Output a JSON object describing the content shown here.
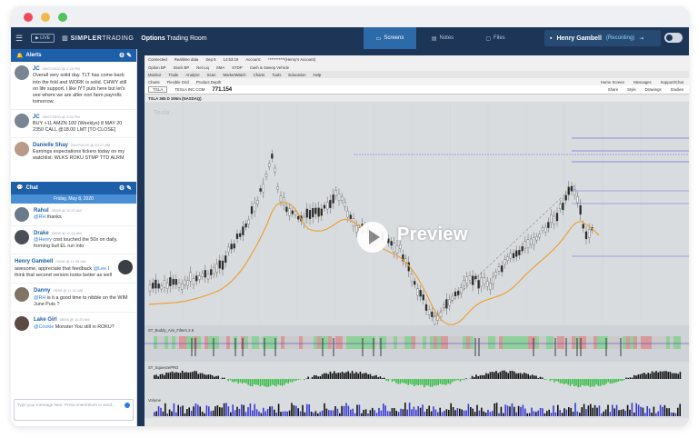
{
  "app": {
    "live_label": "LIVE",
    "brand_bold": "SIMPLER",
    "brand_rest": "TRADING",
    "room_bold": "Options",
    "room_rest": " Trading Room"
  },
  "tabs": [
    {
      "label": "Screens",
      "icon": "monitor-icon"
    },
    {
      "label": "Notes",
      "icon": "notes-icon"
    },
    {
      "label": "Files",
      "icon": "folder-icon"
    }
  ],
  "user": {
    "name": "Henry Gambell",
    "status": "(Recording)"
  },
  "alerts_panel": {
    "title": "Alerts",
    "items": [
      {
        "who": "JC",
        "time": "05/07/2020 @ 2:19 PM",
        "text": "Overall very solid day. TLT has come back into the fold and WORK is solid. CHWY still on life support. I like IYT puts here but let's see where we are after non farm payrolls tomorrow."
      },
      {
        "who": "JC",
        "time": "05/07/2020 @ 2:02 PM",
        "text": "BUY +11 AMZN 100 (Weeklys) 8 MAY 20 2350 CALL @18.00 LMT [TO CLOSE]"
      },
      {
        "who": "Danielle Shay",
        "time": "05/07/2020 @ 10:27 AM",
        "text": "Earnings expectations tickers today on my watchlist: WLKS ROKU STMP TTD ALRM"
      }
    ]
  },
  "chat_panel": {
    "title": "Chat",
    "day": "Friday, May 8, 2020",
    "items": [
      {
        "who": "Rahul",
        "time": "05/08 @ 11:20 AM",
        "mention": "@RH",
        "text": " thanks"
      },
      {
        "who": "Drake",
        "time": "05/08 @ 11:24 AM",
        "mention": "@Henry",
        "text": " cost touched the 50s on daily, forming bull EL run into"
      },
      {
        "who": "Henry Gambell",
        "time": "05/08 @ 11:28 AM",
        "mention": "",
        "text": "awesome, appreciate that feedback ",
        "mention2": "@Lee",
        "text2": " I think that second version looks better as well"
      },
      {
        "who": "Danny",
        "time": "05/08 @ 11:31 AM",
        "mention": "@RH",
        "text": " is it a good time to nibble on the WIM June Puts ?"
      },
      {
        "who": "Lake Girl",
        "time": "05/08 @ 11:33 AM",
        "mention": "@Cookie",
        "text": " Monster You still in ROKU?"
      }
    ],
    "input_placeholder": "Type your message here. Press enter/return to send..."
  },
  "platform": {
    "menu_1": [
      "Connected",
      "Realtime data",
      "Sep 8",
      "14:53:19",
      "Account:",
      "***********(Henry's Account)"
    ],
    "menu_2": [
      "Option BP",
      "Stock BP",
      "Net Liq",
      "SMA",
      "STDP",
      "Cash & Sweep Vehicle"
    ],
    "menu_3": [
      "Monitor",
      "Trade",
      "Analyze",
      "Scan",
      "MarketWatch",
      "Charts",
      "Tools",
      "Education",
      "Help"
    ],
    "chart_tabs": [
      "Charts",
      "Flexible Grid",
      "Product Depth"
    ],
    "right_links": [
      "Home Screen",
      "Messages",
      "Support/Chat"
    ],
    "symbol": "TSLA",
    "company": "TESLA INC COM",
    "last_price": "771.154",
    "tools": [
      "Share",
      "Style",
      "Drawings",
      "Studies"
    ],
    "chart_header": "TSLA 365 D 195m (NASDAQ)",
    "study_1": "ST_Buddy_Aim_Filter1.2.6",
    "study_2": "ST_SqueezePRO",
    "study_3": "Volume",
    "watermark": "Tesla",
    "preview": "Preview"
  },
  "colors": {
    "accent": "#1d5fa8",
    "topbar": "#1d3557",
    "ema": "#e8a23a"
  }
}
